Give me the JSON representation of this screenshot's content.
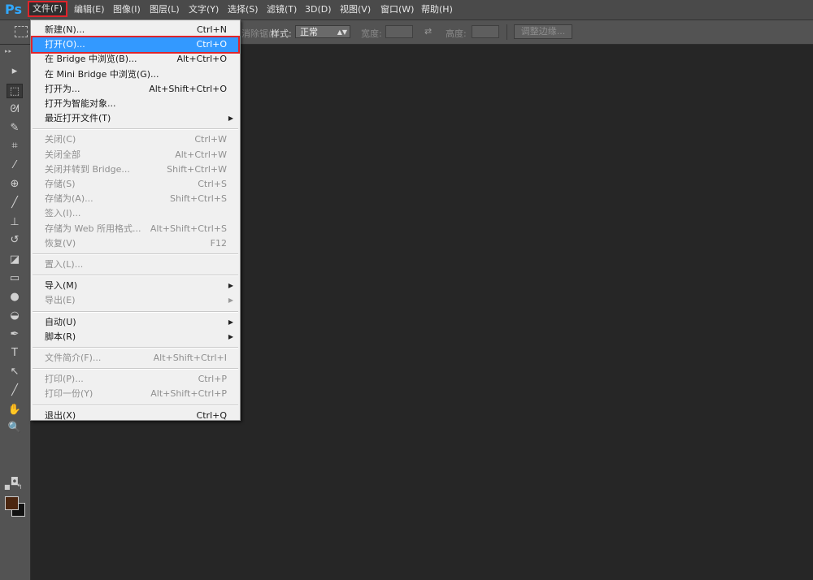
{
  "app": {
    "logo": "Ps"
  },
  "menubar": [
    {
      "label": "文件(F)",
      "active": true
    },
    {
      "label": "编辑(E)"
    },
    {
      "label": "图像(I)"
    },
    {
      "label": "图层(L)"
    },
    {
      "label": "文字(Y)"
    },
    {
      "label": "选择(S)"
    },
    {
      "label": "滤镜(T)"
    },
    {
      "label": "3D(D)"
    },
    {
      "label": "视图(V)"
    },
    {
      "label": "窗口(W)"
    },
    {
      "label": "帮助(H)"
    }
  ],
  "options": {
    "partial_text": "消除锯齿",
    "style_label": "样式:",
    "style_value": "正常",
    "width_label": "宽度:",
    "height_label": "高度:",
    "refine_button": "调整边缘..."
  },
  "file_menu": {
    "items": [
      {
        "label": "新建(N)...",
        "shortcut": "Ctrl+N",
        "enabled": true
      },
      {
        "label": "打开(O)...",
        "shortcut": "Ctrl+O",
        "enabled": true,
        "highlighted": true
      },
      {
        "label": "在 Bridge 中浏览(B)...",
        "shortcut": "Alt+Ctrl+O",
        "enabled": true
      },
      {
        "label": "在 Mini Bridge 中浏览(G)...",
        "shortcut": "",
        "enabled": true
      },
      {
        "label": "打开为...",
        "shortcut": "Alt+Shift+Ctrl+O",
        "enabled": true
      },
      {
        "label": "打开为智能对象...",
        "shortcut": "",
        "enabled": true
      },
      {
        "label": "最近打开文件(T)",
        "shortcut": "",
        "enabled": true,
        "submenu": true
      },
      {
        "separator": true
      },
      {
        "label": "关闭(C)",
        "shortcut": "Ctrl+W",
        "enabled": false
      },
      {
        "label": "关闭全部",
        "shortcut": "Alt+Ctrl+W",
        "enabled": false
      },
      {
        "label": "关闭并转到 Bridge...",
        "shortcut": "Shift+Ctrl+W",
        "enabled": false
      },
      {
        "label": "存储(S)",
        "shortcut": "Ctrl+S",
        "enabled": false
      },
      {
        "label": "存储为(A)...",
        "shortcut": "Shift+Ctrl+S",
        "enabled": false
      },
      {
        "label": "签入(I)...",
        "shortcut": "",
        "enabled": false
      },
      {
        "label": "存储为 Web 所用格式...",
        "shortcut": "Alt+Shift+Ctrl+S",
        "enabled": false
      },
      {
        "label": "恢复(V)",
        "shortcut": "F12",
        "enabled": false
      },
      {
        "separator": true
      },
      {
        "label": "置入(L)...",
        "shortcut": "",
        "enabled": false
      },
      {
        "separator": true
      },
      {
        "label": "导入(M)",
        "shortcut": "",
        "enabled": true,
        "submenu": true
      },
      {
        "label": "导出(E)",
        "shortcut": "",
        "enabled": false,
        "submenu": true
      },
      {
        "separator": true
      },
      {
        "label": "自动(U)",
        "shortcut": "",
        "enabled": true,
        "submenu": true
      },
      {
        "label": "脚本(R)",
        "shortcut": "",
        "enabled": true,
        "submenu": true
      },
      {
        "separator": true
      },
      {
        "label": "文件简介(F)...",
        "shortcut": "Alt+Shift+Ctrl+I",
        "enabled": false
      },
      {
        "separator": true
      },
      {
        "label": "打印(P)...",
        "shortcut": "Ctrl+P",
        "enabled": false
      },
      {
        "label": "打印一份(Y)",
        "shortcut": "Alt+Shift+Ctrl+P",
        "enabled": false
      },
      {
        "separator": true
      },
      {
        "label": "退出(X)",
        "shortcut": "Ctrl+Q",
        "enabled": true
      }
    ]
  },
  "tools": [
    {
      "name": "move-tool-icon",
      "glyph": "▸"
    },
    {
      "name": "marquee-tool-icon",
      "glyph": "⬚",
      "selected": true
    },
    {
      "name": "lasso-tool-icon",
      "glyph": "ᘛ"
    },
    {
      "name": "quick-selection-tool-icon",
      "glyph": "✎"
    },
    {
      "name": "crop-tool-icon",
      "glyph": "⌗"
    },
    {
      "name": "eyedropper-tool-icon",
      "glyph": "⁄"
    },
    {
      "name": "healing-brush-tool-icon",
      "glyph": "⊕"
    },
    {
      "name": "brush-tool-icon",
      "glyph": "╱"
    },
    {
      "name": "clone-stamp-tool-icon",
      "glyph": "⊥"
    },
    {
      "name": "history-brush-tool-icon",
      "glyph": "↺"
    },
    {
      "name": "eraser-tool-icon",
      "glyph": "◪"
    },
    {
      "name": "gradient-tool-icon",
      "glyph": "▭"
    },
    {
      "name": "blur-tool-icon",
      "glyph": "●"
    },
    {
      "name": "dodge-tool-icon",
      "glyph": "◒"
    },
    {
      "name": "pen-tool-icon",
      "glyph": "✒"
    },
    {
      "name": "type-tool-icon",
      "glyph": "T"
    },
    {
      "name": "path-selection-tool-icon",
      "glyph": "↖"
    },
    {
      "name": "line-tool-icon",
      "glyph": "╱"
    },
    {
      "name": "hand-tool-icon",
      "glyph": "✋"
    },
    {
      "name": "zoom-tool-icon",
      "glyph": "🔍"
    }
  ],
  "colors": {
    "foreground": "#4b2610",
    "background": "#111111",
    "highlight": "#3399ff",
    "annotation_red": "#e0242b"
  }
}
